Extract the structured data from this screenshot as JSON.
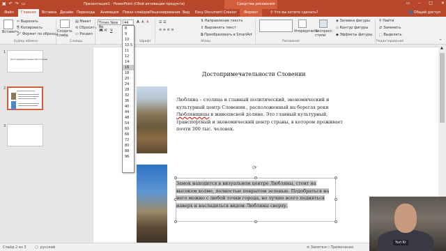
{
  "app": {
    "title": "Презентация1 - PowerPoint (Сбой активации продукта)",
    "contextual_title": "Средства рисования",
    "user": "Yuri Kr",
    "colors": {
      "accent": "#b7472a",
      "contextual": "#d35e3c"
    }
  },
  "tabs": [
    {
      "label": "Файл"
    },
    {
      "label": "Главная"
    },
    {
      "label": "Вставка"
    },
    {
      "label": "Дизайн"
    },
    {
      "label": "Переходы"
    },
    {
      "label": "Анимация"
    },
    {
      "label": "Показ слайдов"
    },
    {
      "label": "Рецензирование"
    },
    {
      "label": "Вид"
    },
    {
      "label": "Easy Document Creator"
    },
    {
      "label": "Формат"
    }
  ],
  "tellme": "Что вы хотите сделать?",
  "share": "Общий доступ",
  "ribbon": {
    "paste": "Вставить",
    "cut": "Вырезать",
    "copy": "Копировать",
    "format_painter": "Формат по образцу",
    "clipboard_group": "Буфер обмена",
    "new_slide": "Создать слайд",
    "layout": "Макет",
    "reset": "Сбросить",
    "section": "Раздел",
    "slides_group": "Слайды",
    "font_name": "Times New Ro",
    "font_size": "44",
    "font_group": "Шрифт",
    "text_direction": "Направление текста",
    "align_text": "Выровнять текст",
    "smartart": "Преобразовать в SmartArt",
    "paragraph_group": "Абзац",
    "arrange": "Упорядочить",
    "quick_styles": "Экспресс-стили",
    "drawing_group": "Рисование",
    "shape_fill": "Заливка фигуры",
    "shape_outline": "Контур фигуры",
    "shape_effects": "Эффекты фигуры",
    "find": "Найти",
    "replace": "Заменить",
    "select": "Выделить",
    "editing_group": "Редактирование"
  },
  "font_sizes": [
    "8",
    "9",
    "10",
    "10,5",
    "11",
    "12",
    "14",
    "16",
    "18",
    "20",
    "24",
    "28",
    "32",
    "36",
    "40",
    "44",
    "48",
    "54",
    "60",
    "66",
    "72",
    "80",
    "88",
    "96"
  ],
  "selected_font_size": "16",
  "thumbnails": [
    {
      "num": "1",
      "title": "Достопримечательности Словении"
    },
    {
      "num": "2"
    },
    {
      "num": "3"
    }
  ],
  "slide": {
    "title": "Достопримечательности Словении",
    "para1_before": "Любляна – столица и главный политический, экономический и культурный центр Словении., расположенный на берегах реки ",
    "para1_word": "Люблянщицы",
    "para1_after": " в живописной долине. Это главный культурный, транспортный и экономический центр страны, в котором проживает почти 300 тыс. человек.",
    "para2": "Замок находится в визуальном центре Любляны, стоит на высоком холме, полностью покрытом зеленью. Подобраться на него можно с любой точки города, но лучше всего подняться наверх и насладиться видом Любляны сверху."
  },
  "status": {
    "slide_info": "Слайд 2 из 3",
    "language": "русский",
    "notes": "Заметки",
    "comments": "Примечания"
  }
}
